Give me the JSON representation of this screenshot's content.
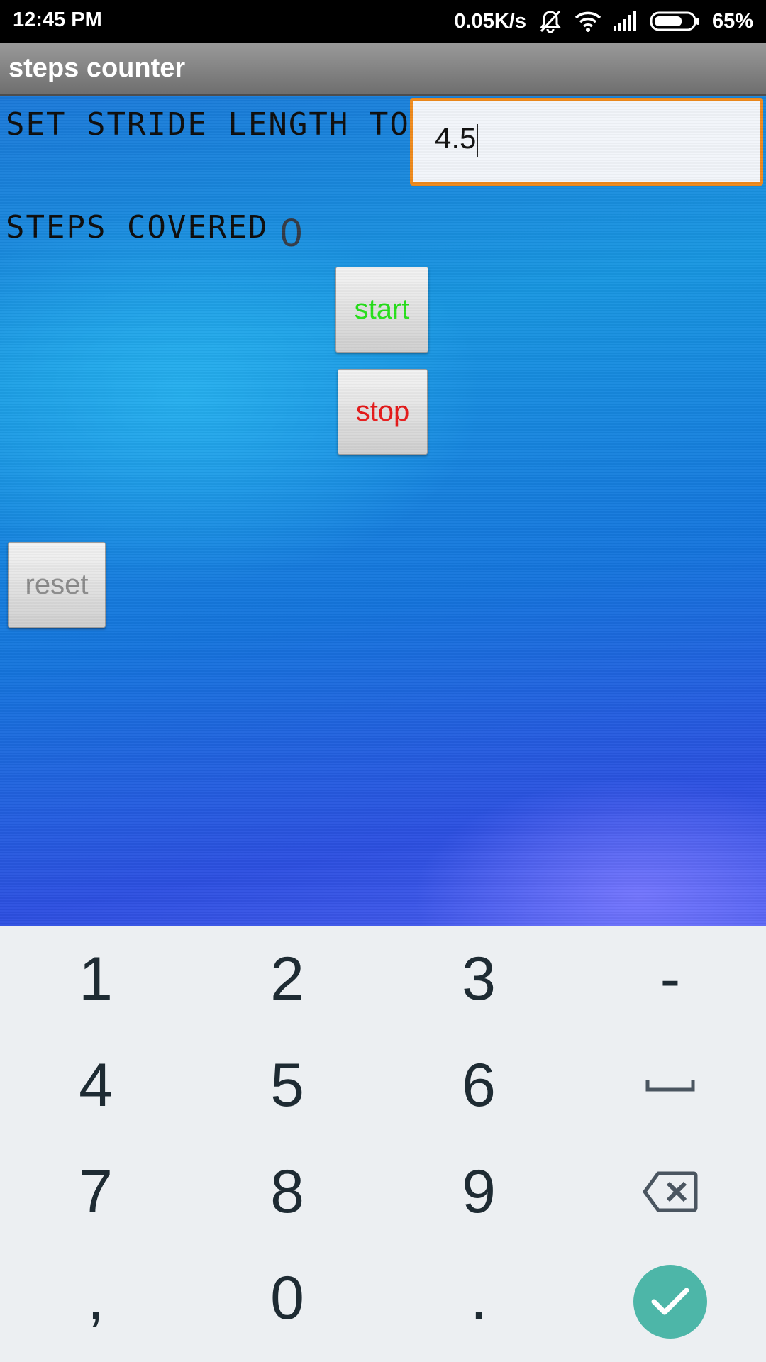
{
  "status_bar": {
    "time": "12:45 PM",
    "network_speed": "0.05K/s",
    "battery_percent": "65%",
    "battery_level": 0.65,
    "icons": [
      "mute-icon",
      "wifi-icon",
      "signal-icon",
      "battery-icon"
    ]
  },
  "app": {
    "title": "steps counter"
  },
  "form": {
    "stride_label": "SET STRIDE LENGTH TO:",
    "stride_value": "4.5",
    "steps_label": "STEPS COVERED",
    "steps_value": "0"
  },
  "buttons": {
    "start": "start",
    "stop": "stop",
    "reset": "reset"
  },
  "keyboard": {
    "row1": [
      "1",
      "2",
      "3",
      "-"
    ],
    "row2": [
      "4",
      "5",
      "6"
    ],
    "row3": [
      "7",
      "8",
      "9"
    ],
    "row4": [
      ",",
      "0",
      "."
    ],
    "special_icons": [
      "space-icon",
      "backspace-icon",
      "enter-check-icon"
    ]
  },
  "colors": {
    "input_border": "#f08a1c",
    "start_text": "#26e01a",
    "stop_text": "#e61a1a",
    "reset_text": "#8a8a8a",
    "enter_key": "#4db6a8"
  }
}
